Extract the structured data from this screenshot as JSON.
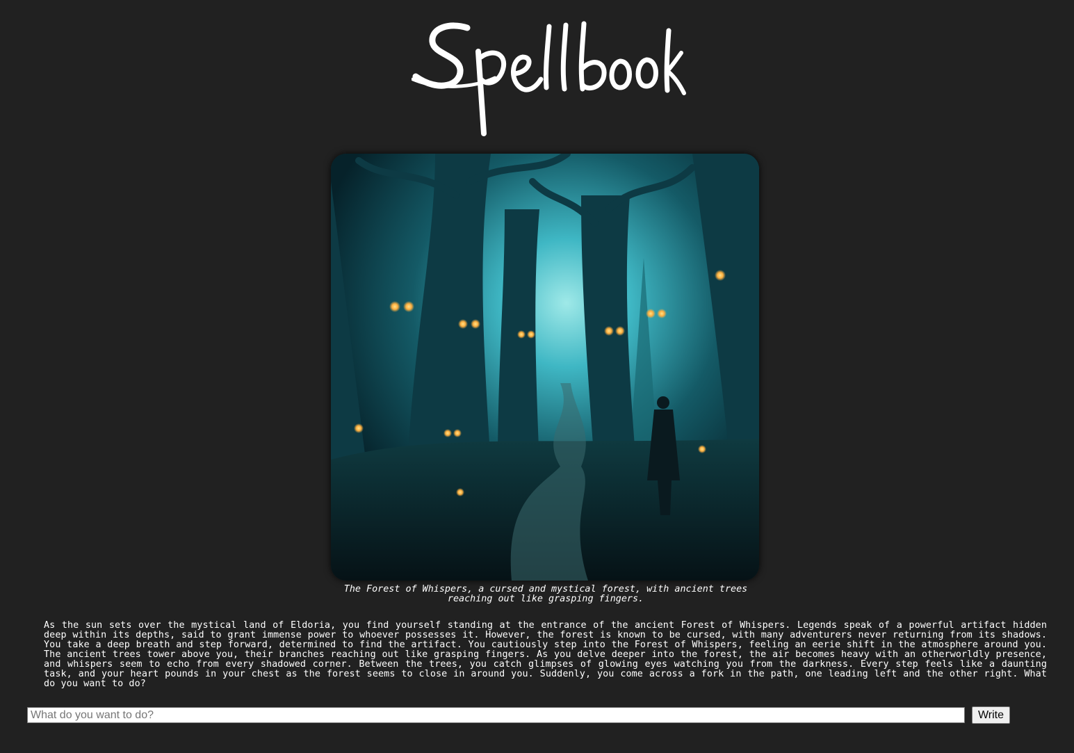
{
  "header": {
    "logo_text": "Spellbook"
  },
  "scene": {
    "image_subject": "forest-of-whispers-illustration",
    "caption": "The Forest of Whispers, a cursed and mystical forest, with ancient trees reaching out like grasping fingers."
  },
  "story": {
    "text": "As the sun sets over the mystical land of Eldoria, you find yourself standing at the entrance of the ancient Forest of Whispers. Legends speak of a powerful artifact hidden deep within its depths, said to grant immense power to whoever possesses it. However, the forest is known to be cursed, with many adventurers never returning from its shadows. You take a deep breath and step forward, determined to find the artifact. You cautiously step into the Forest of Whispers, feeling an eerie shift in the atmosphere around you. The ancient trees tower above you, their branches reaching out like grasping fingers. As you delve deeper into the forest, the air becomes heavy with an otherworldly presence, and whispers seem to echo from every shadowed corner. Between the trees, you catch glimpses of glowing eyes watching you from the darkness. Every step feels like a daunting task, and your heart pounds in your chest as the forest seems to close in around you. Suddenly, you come across a fork in the path, one leading left and the other right. What do you want to do?"
  },
  "action": {
    "placeholder": "What do you want to do?",
    "value": "",
    "submit_label": "Write"
  },
  "colors": {
    "background": "#212121",
    "text": "#ffffff",
    "scene_teal": "#3fb7c4",
    "scene_glow": "#ffb040"
  }
}
